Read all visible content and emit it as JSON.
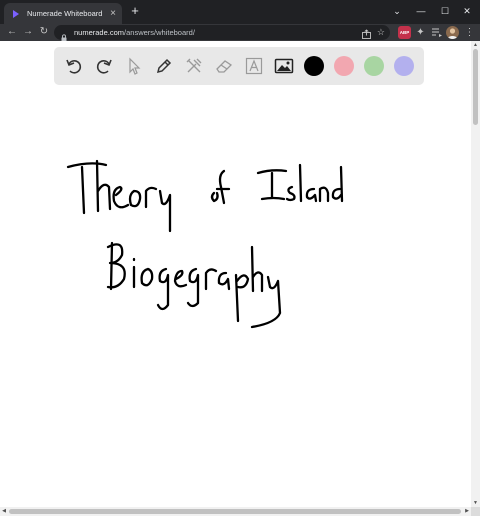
{
  "browser": {
    "tab_title": "Numerade Whiteboard",
    "tab_close": "×",
    "new_tab": "+",
    "window_controls": {
      "minimize": "⌄",
      "restore": "—",
      "maximize": "☐",
      "close": "✕"
    },
    "url_host": "numerade.com",
    "url_path": "/answers/whiteboard/",
    "extension_abp_label": "ABP"
  },
  "whiteboard": {
    "tools": [
      "undo-icon",
      "redo-icon",
      "select-icon",
      "pen-icon",
      "tools-icon",
      "eraser-icon",
      "text-icon",
      "image-icon"
    ],
    "colors": [
      "#000000",
      "#f2a7b0",
      "#a8d5a2",
      "#b3b0ee"
    ],
    "handwriting_line1": "Theory of Island",
    "handwriting_line2": "Biogeography"
  }
}
